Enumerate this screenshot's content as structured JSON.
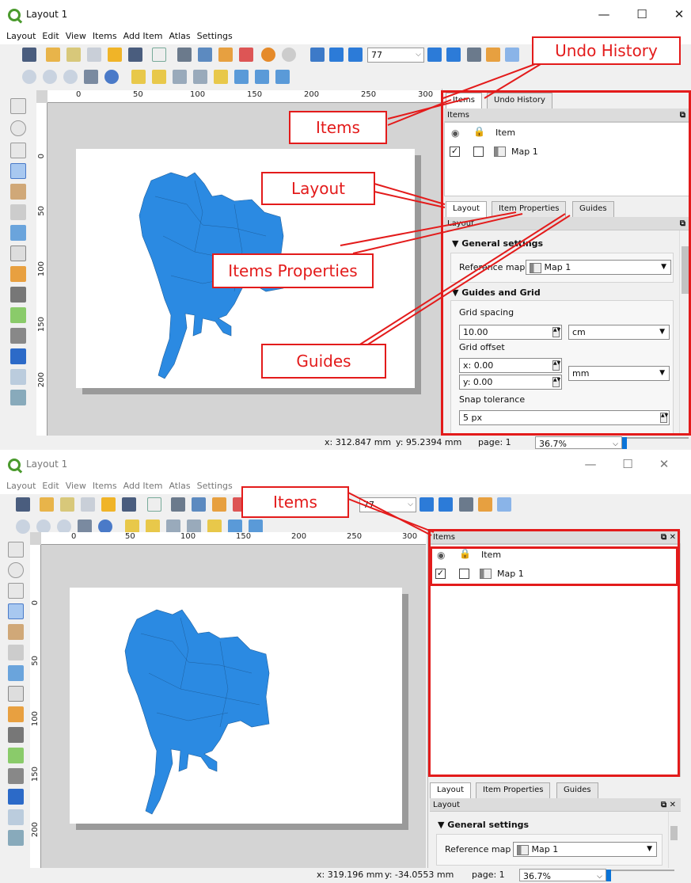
{
  "window_top": {
    "title": "Layout 1",
    "controls": {
      "minimize": "—",
      "maximize": "☐",
      "close": "✕"
    },
    "menu": [
      "Layout",
      "Edit",
      "View",
      "Items",
      "Add Item",
      "Atlas",
      "Settings"
    ],
    "page_spinner": "77",
    "ruler_h_labels": [
      "0",
      "50",
      "100",
      "150",
      "200",
      "250",
      "300"
    ],
    "ruler_v_labels": [
      "0",
      "50",
      "100",
      "150",
      "200"
    ],
    "tabs_top": [
      "Items",
      "Undo History"
    ],
    "items_panel_title": "Items",
    "items_header": "Item",
    "map_item": "Map 1",
    "tabs_bottom": [
      "Layout",
      "Item Properties",
      "Guides"
    ],
    "layout_panel_title": "Layout",
    "general_settings": "General settings",
    "reference_map_label": "Reference map",
    "reference_map_value": "Map 1",
    "guides_grid": "Guides and Grid",
    "grid_spacing_label": "Grid spacing",
    "grid_spacing_value": "10.00",
    "grid_spacing_unit": "cm",
    "grid_offset_label": "Grid offset",
    "offset_x": "x: 0.00",
    "offset_y": "y: 0.00",
    "offset_unit": "mm",
    "snap_tolerance_label": "Snap tolerance",
    "snap_tolerance_value": "5 px",
    "status_x": "x: 312.847 mm",
    "status_y": "y: 95.2394 mm",
    "status_page": "page: 1",
    "zoom": "36.7%",
    "callouts": {
      "undo_history": "Undo History",
      "items": "Items",
      "layout": "Layout",
      "item_properties": "Items Properties",
      "guides": "Guides"
    }
  },
  "window_bottom": {
    "title": "Layout 1",
    "controls": {
      "minimize": "—",
      "maximize": "☐",
      "close": "✕"
    },
    "menu": [
      "Layout",
      "Edit",
      "View",
      "Items",
      "Add Item",
      "Atlas",
      "Settings"
    ],
    "page_spinner": "77",
    "ruler_h_labels": [
      "0",
      "50",
      "100",
      "150",
      "200",
      "250",
      "300"
    ],
    "ruler_v_labels": [
      "0",
      "50",
      "100",
      "150",
      "200"
    ],
    "items_panel_title": "Items",
    "items_header": "Item",
    "map_item": "Map 1",
    "tabs_bottom": [
      "Layout",
      "Item Properties",
      "Guides"
    ],
    "layout_panel_title": "Layout",
    "general_settings": "General settings",
    "reference_map_label": "Reference map",
    "reference_map_value": "Map 1",
    "status_x": "x: 319.196 mm",
    "status_y": "y: -34.0553 mm",
    "status_page": "page: 1",
    "zoom": "36.7%",
    "callouts": {
      "items": "Items"
    }
  },
  "colors": {
    "callout_red": "#e31b1b",
    "map_fill": "#2b8ae2",
    "accent": "#0a74d8"
  },
  "icons": [
    "save-icon",
    "new-layout-icon",
    "duplicate-icon",
    "layout-manager-icon",
    "open-folder-icon",
    "save-template-icon",
    "page-icon",
    "print-icon",
    "export-image-icon",
    "export-svg-icon",
    "export-pdf-icon",
    "undo-icon",
    "redo-icon",
    "atlas-preview-icon",
    "first-feature-icon",
    "previous-feature-icon",
    "next-feature-icon",
    "last-feature-icon",
    "zoom-in-icon",
    "zoom-out-icon",
    "zoom-actual-icon",
    "zoom-full-icon",
    "refresh-icon",
    "pan-icon",
    "zoom-tool-icon",
    "select-icon",
    "move-content-icon",
    "edit-nodes-icon",
    "add-map-icon",
    "add-picture-icon",
    "add-label-icon",
    "add-legend-icon",
    "add-scalebar-icon",
    "add-shape-icon",
    "add-arrow-icon",
    "add-node-item-icon",
    "add-html-icon",
    "add-table-icon"
  ]
}
